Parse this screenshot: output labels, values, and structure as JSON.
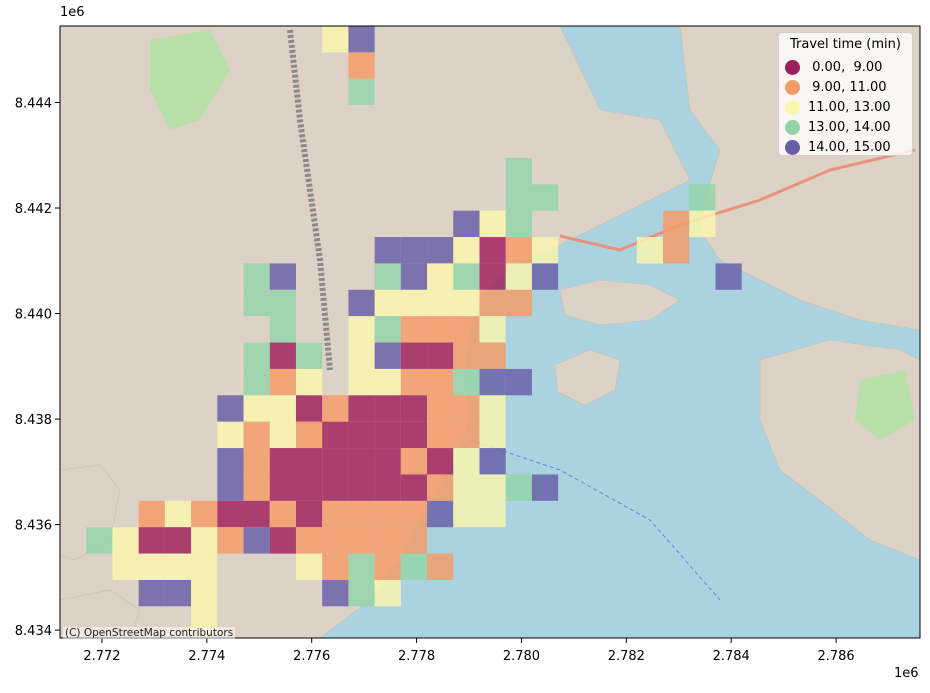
{
  "chart_data": {
    "type": "heatmap",
    "subtype": "choropleth grid over basemap",
    "legend": {
      "title": "Travel time (min)",
      "placement": "top-right",
      "classes": [
        {
          "label": " 0.00,  9.00",
          "color": "#9e1d5c"
        },
        {
          "label": " 9.00, 11.00",
          "color": "#f59b66"
        },
        {
          "label": "11.00, 13.00",
          "color": "#fbf6ad"
        },
        {
          "label": "13.00, 14.00",
          "color": "#92d4a8"
        },
        {
          "label": "14.00, 15.00",
          "color": "#675ea8"
        }
      ]
    },
    "x_axis": {
      "ticks": [
        "2.772",
        "2.774",
        "2.776",
        "2.778",
        "2.780",
        "2.782",
        "2.784",
        "2.786"
      ],
      "exponent_label": "1e6",
      "range": [
        2.7712,
        2.7876
      ]
    },
    "y_axis": {
      "ticks": [
        "8.434",
        "8.436",
        "8.438",
        "8.440",
        "8.442",
        "8.444"
      ],
      "exponent_label": "1e6",
      "range": [
        8.43385,
        8.44545
      ]
    },
    "basemap": {
      "attribution": "(C) OpenStreetMap contributors",
      "sea_color": "#aad3df",
      "land_color": "#dcd3c6"
    },
    "grid_x0": 2.7717,
    "grid_y0": 8.4364,
    "grid_step": 0.0005,
    "rows": [
      {
        "y": 8.44545,
        "cells": [
          {
            "i": 9,
            "c": 2
          },
          {
            "i": 10,
            "c": 4
          }
        ]
      },
      {
        "y": 8.44495,
        "cells": [
          {
            "i": 10,
            "c": 1
          }
        ]
      },
      {
        "y": 8.44445,
        "cells": [
          {
            "i": 10,
            "c": 3
          }
        ]
      },
      {
        "y": 8.44295,
        "cells": [
          {
            "i": 16,
            "c": 3
          }
        ]
      },
      {
        "y": 8.44245,
        "cells": [
          {
            "i": 16,
            "c": 3
          },
          {
            "i": 17,
            "c": 3
          },
          {
            "i": 23,
            "c": 3
          }
        ]
      },
      {
        "y": 8.44195,
        "cells": [
          {
            "i": 14,
            "c": 4
          },
          {
            "i": 15,
            "c": 2
          },
          {
            "i": 16,
            "c": 3
          },
          {
            "i": 22,
            "c": 1
          },
          {
            "i": 23,
            "c": 2
          }
        ]
      },
      {
        "y": 8.44145,
        "cells": [
          {
            "i": 11,
            "c": 4
          },
          {
            "i": 12,
            "c": 4
          },
          {
            "i": 13,
            "c": 4
          },
          {
            "i": 14,
            "c": 2
          },
          {
            "i": 15,
            "c": 0
          },
          {
            "i": 16,
            "c": 1
          },
          {
            "i": 17,
            "c": 2
          },
          {
            "i": 21,
            "c": 2
          },
          {
            "i": 22,
            "c": 1
          }
        ]
      },
      {
        "y": 8.44095,
        "cells": [
          {
            "i": 6,
            "c": 3
          },
          {
            "i": 7,
            "c": 4
          },
          {
            "i": 11,
            "c": 3
          },
          {
            "i": 12,
            "c": 4
          },
          {
            "i": 13,
            "c": 2
          },
          {
            "i": 14,
            "c": 3
          },
          {
            "i": 15,
            "c": 0
          },
          {
            "i": 16,
            "c": 2
          },
          {
            "i": 17,
            "c": 4
          },
          {
            "i": 24,
            "c": 4
          }
        ]
      },
      {
        "y": 8.44045,
        "cells": [
          {
            "i": 6,
            "c": 3
          },
          {
            "i": 7,
            "c": 3
          },
          {
            "i": 10,
            "c": 4
          },
          {
            "i": 11,
            "c": 2
          },
          {
            "i": 12,
            "c": 2
          },
          {
            "i": 13,
            "c": 2
          },
          {
            "i": 14,
            "c": 2
          },
          {
            "i": 15,
            "c": 1
          },
          {
            "i": 16,
            "c": 1
          }
        ]
      },
      {
        "y": 8.43995,
        "cells": [
          {
            "i": 7,
            "c": 3
          },
          {
            "i": 10,
            "c": 2
          },
          {
            "i": 11,
            "c": 3
          },
          {
            "i": 12,
            "c": 1
          },
          {
            "i": 13,
            "c": 1
          },
          {
            "i": 14,
            "c": 1
          },
          {
            "i": 15,
            "c": 2
          }
        ]
      },
      {
        "y": 8.43945,
        "cells": [
          {
            "i": 6,
            "c": 3
          },
          {
            "i": 7,
            "c": 0
          },
          {
            "i": 8,
            "c": 3
          },
          {
            "i": 10,
            "c": 2
          },
          {
            "i": 11,
            "c": 4
          },
          {
            "i": 12,
            "c": 0
          },
          {
            "i": 13,
            "c": 0
          },
          {
            "i": 14,
            "c": 1
          },
          {
            "i": 15,
            "c": 1
          }
        ]
      },
      {
        "y": 8.43895,
        "cells": [
          {
            "i": 6,
            "c": 3
          },
          {
            "i": 7,
            "c": 1
          },
          {
            "i": 8,
            "c": 2
          },
          {
            "i": 10,
            "c": 2
          },
          {
            "i": 11,
            "c": 2
          },
          {
            "i": 12,
            "c": 1
          },
          {
            "i": 13,
            "c": 1
          },
          {
            "i": 14,
            "c": 3
          },
          {
            "i": 15,
            "c": 4
          },
          {
            "i": 16,
            "c": 4
          }
        ]
      },
      {
        "y": 8.43845,
        "cells": [
          {
            "i": 5,
            "c": 4
          },
          {
            "i": 6,
            "c": 2
          },
          {
            "i": 7,
            "c": 2
          },
          {
            "i": 8,
            "c": 0
          },
          {
            "i": 9,
            "c": 1
          },
          {
            "i": 10,
            "c": 0
          },
          {
            "i": 11,
            "c": 0
          },
          {
            "i": 12,
            "c": 0
          },
          {
            "i": 13,
            "c": 1
          },
          {
            "i": 14,
            "c": 1
          },
          {
            "i": 15,
            "c": 2
          }
        ]
      },
      {
        "y": 8.43795,
        "cells": [
          {
            "i": 5,
            "c": 2
          },
          {
            "i": 6,
            "c": 1
          },
          {
            "i": 7,
            "c": 2
          },
          {
            "i": 8,
            "c": 1
          },
          {
            "i": 9,
            "c": 0
          },
          {
            "i": 10,
            "c": 0
          },
          {
            "i": 11,
            "c": 0
          },
          {
            "i": 12,
            "c": 0
          },
          {
            "i": 13,
            "c": 1
          },
          {
            "i": 14,
            "c": 1
          },
          {
            "i": 15,
            "c": 2
          }
        ]
      },
      {
        "y": 8.43745,
        "cells": [
          {
            "i": 5,
            "c": 4
          },
          {
            "i": 6,
            "c": 1
          },
          {
            "i": 7,
            "c": 0
          },
          {
            "i": 8,
            "c": 0
          },
          {
            "i": 9,
            "c": 0
          },
          {
            "i": 10,
            "c": 0
          },
          {
            "i": 11,
            "c": 0
          },
          {
            "i": 12,
            "c": 1
          },
          {
            "i": 13,
            "c": 0
          },
          {
            "i": 14,
            "c": 2
          },
          {
            "i": 15,
            "c": 4
          }
        ]
      },
      {
        "y": 8.43695,
        "cells": [
          {
            "i": 5,
            "c": 4
          },
          {
            "i": 6,
            "c": 1
          },
          {
            "i": 7,
            "c": 0
          },
          {
            "i": 8,
            "c": 0
          },
          {
            "i": 9,
            "c": 0
          },
          {
            "i": 10,
            "c": 0
          },
          {
            "i": 11,
            "c": 0
          },
          {
            "i": 12,
            "c": 0
          },
          {
            "i": 13,
            "c": 1
          },
          {
            "i": 14,
            "c": 2
          },
          {
            "i": 15,
            "c": 2
          },
          {
            "i": 16,
            "c": 3
          },
          {
            "i": 17,
            "c": 4
          }
        ]
      },
      {
        "y": 8.43645,
        "cells": [
          {
            "i": 2,
            "c": 1
          },
          {
            "i": 3,
            "c": 2
          },
          {
            "i": 4,
            "c": 1
          },
          {
            "i": 5,
            "c": 0
          },
          {
            "i": 6,
            "c": 0
          },
          {
            "i": 7,
            "c": 1
          },
          {
            "i": 8,
            "c": 0
          },
          {
            "i": 9,
            "c": 1
          },
          {
            "i": 10,
            "c": 1
          },
          {
            "i": 11,
            "c": 1
          },
          {
            "i": 12,
            "c": 1
          },
          {
            "i": 13,
            "c": 4
          },
          {
            "i": 14,
            "c": 2
          },
          {
            "i": 15,
            "c": 2
          }
        ]
      },
      {
        "y": 8.43595,
        "cells": [
          {
            "i": 0,
            "c": 3
          },
          {
            "i": 1,
            "c": 2
          },
          {
            "i": 2,
            "c": 0
          },
          {
            "i": 3,
            "c": 0
          },
          {
            "i": 4,
            "c": 2
          },
          {
            "i": 5,
            "c": 1
          },
          {
            "i": 6,
            "c": 4
          },
          {
            "i": 7,
            "c": 0
          },
          {
            "i": 8,
            "c": 1
          },
          {
            "i": 9,
            "c": 1
          },
          {
            "i": 10,
            "c": 1
          },
          {
            "i": 11,
            "c": 1
          },
          {
            "i": 12,
            "c": 1
          }
        ]
      },
      {
        "y": 8.43545,
        "cells": [
          {
            "i": 1,
            "c": 2
          },
          {
            "i": 2,
            "c": 2
          },
          {
            "i": 3,
            "c": 2
          },
          {
            "i": 4,
            "c": 2
          },
          {
            "i": 8,
            "c": 2
          },
          {
            "i": 9,
            "c": 1
          },
          {
            "i": 10,
            "c": 3
          },
          {
            "i": 11,
            "c": 1
          },
          {
            "i": 12,
            "c": 3
          },
          {
            "i": 13,
            "c": 1
          }
        ]
      },
      {
        "y": 8.43495,
        "cells": [
          {
            "i": 2,
            "c": 4
          },
          {
            "i": 3,
            "c": 4
          },
          {
            "i": 4,
            "c": 2
          },
          {
            "i": 9,
            "c": 4
          },
          {
            "i": 10,
            "c": 3
          },
          {
            "i": 11,
            "c": 2
          }
        ]
      },
      {
        "y": 8.43445,
        "cells": [
          {
            "i": 4,
            "c": 2
          }
        ]
      }
    ]
  }
}
